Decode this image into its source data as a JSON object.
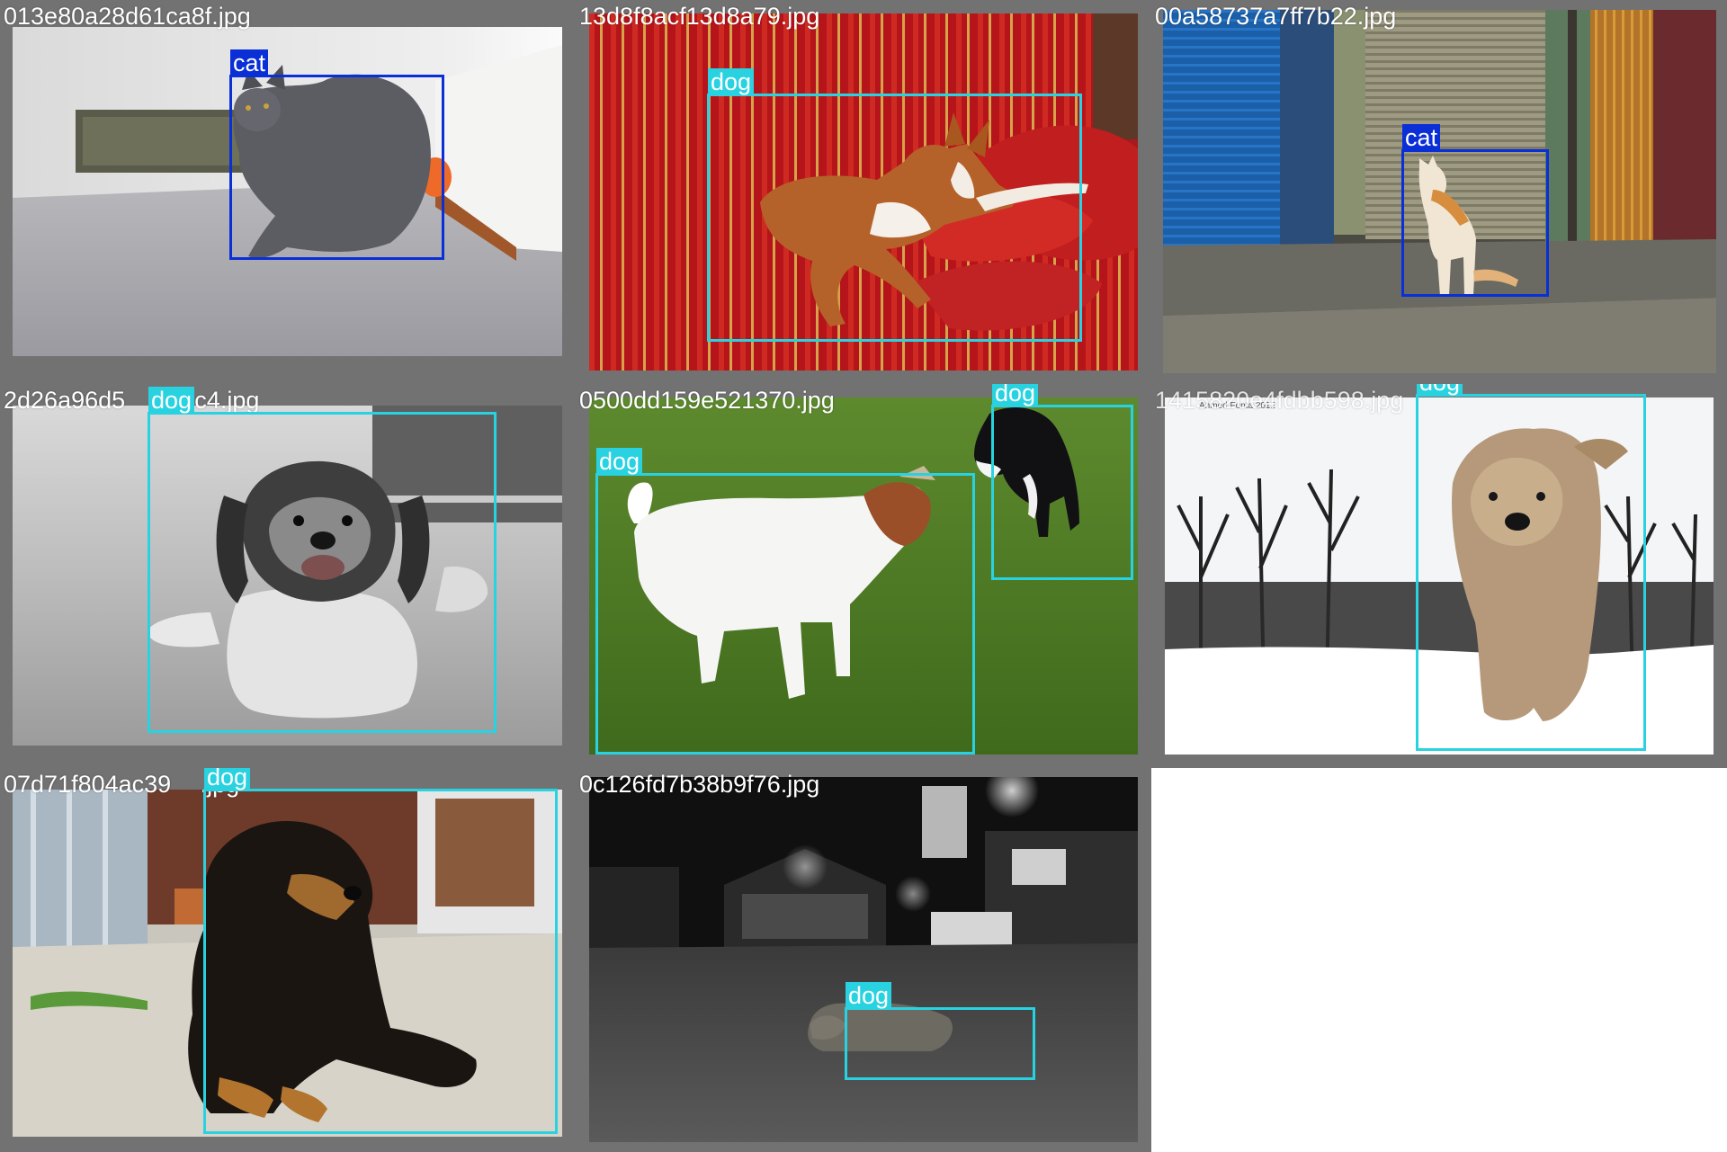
{
  "colors": {
    "tile_border": "#727272",
    "background": "#ffffff",
    "filename_text": "#ffffff",
    "class_cat": "#0a2fd6",
    "class_dog": "#29d2e0"
  },
  "tiles": [
    {
      "filename": "013e80a28d61ca8f.jpg",
      "boxes": [
        {
          "label": "cat"
        }
      ],
      "watermark": ""
    },
    {
      "filename": "13d8f8acf13d8a79.jpg",
      "boxes": [
        {
          "label": "dog"
        }
      ],
      "watermark": ""
    },
    {
      "filename": "00a58737a7ff7b22.jpg",
      "boxes": [
        {
          "label": "cat"
        }
      ],
      "watermark": ""
    },
    {
      "filename": "2d26a96d5         c7c4.jpg",
      "boxes": [
        {
          "label": "dog"
        }
      ],
      "watermark": ""
    },
    {
      "filename": "0500dd159e521370.jpg",
      "boxes": [
        {
          "label": "dog"
        },
        {
          "label": "dog"
        }
      ],
      "watermark": ""
    },
    {
      "filename": "1415820e4fdbb598.jpg",
      "boxes": [
        {
          "label": "dog"
        }
      ],
      "watermark": "Ahmed Fonta 2012"
    },
    {
      "filename": "07d71f804ac39      .jpg",
      "boxes": [
        {
          "label": "dog"
        }
      ],
      "watermark": ""
    },
    {
      "filename": "0c126fd7b38b9f76.jpg",
      "boxes": [
        {
          "label": "dog"
        }
      ],
      "watermark": ""
    }
  ]
}
